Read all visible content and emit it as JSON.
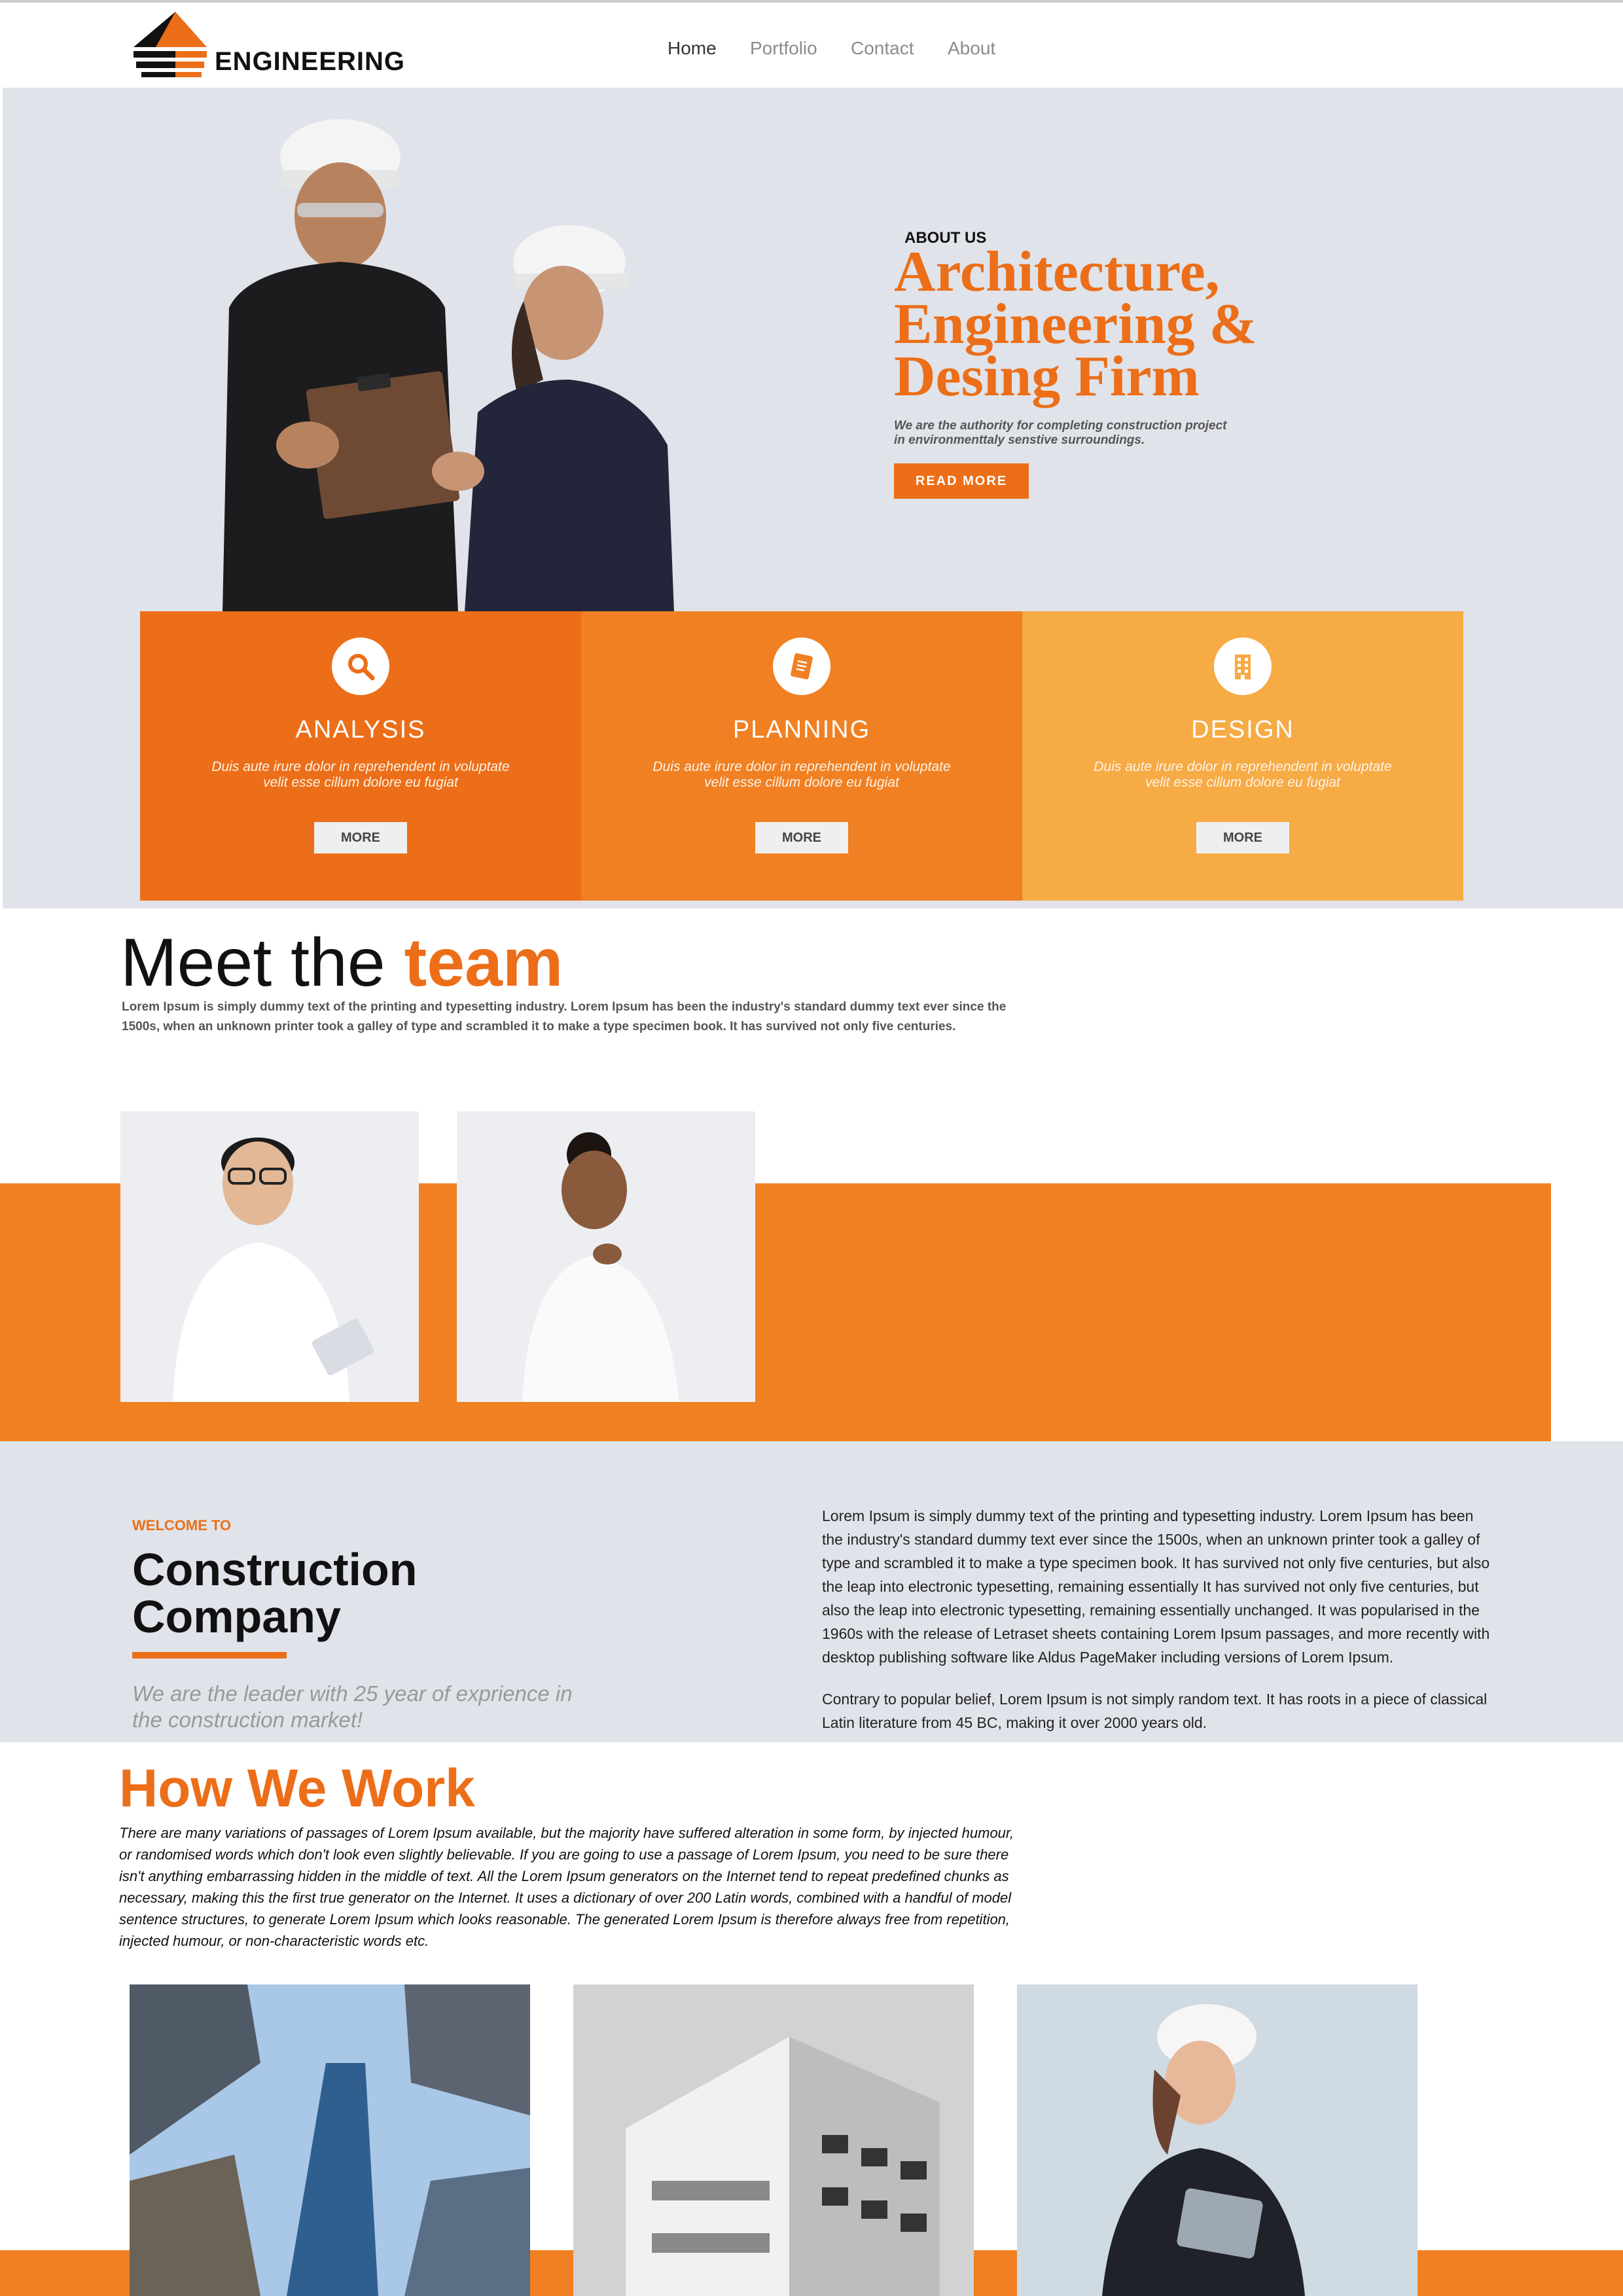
{
  "brand": {
    "name": "ENGINEERING",
    "accent": "#ec6e18"
  },
  "nav": [
    {
      "label": "Home",
      "active": true
    },
    {
      "label": "Portfolio",
      "active": false
    },
    {
      "label": "Contact",
      "active": false
    },
    {
      "label": "About",
      "active": false
    }
  ],
  "hero": {
    "kicker": "ABOUT US",
    "title_line1": "Architecture,",
    "title_line2": "Engineering &",
    "title_line3": "Desing Firm",
    "subtitle_line1": "We are the authority for completing construction project",
    "subtitle_line2": "in environmenttaly senstive surroundings.",
    "cta": "READ MORE"
  },
  "services": [
    {
      "title": "ANALYSIS",
      "icon": "search-icon",
      "desc_line1": "Duis aute irure dolor in reprehendent in voluptate",
      "desc_line2": "velit esse cillum dolore eu fugiat",
      "button": "MORE",
      "color": "#ec6e18"
    },
    {
      "title": "PLANNING",
      "icon": "book-icon",
      "desc_line1": "Duis aute irure dolor in reprehendent in voluptate",
      "desc_line2": "velit esse cillum dolore eu fugiat",
      "button": "MORE",
      "color": "#f08022"
    },
    {
      "title": "DESIGN",
      "icon": "building-icon",
      "desc_line1": "Duis aute irure dolor in reprehendent in voluptate",
      "desc_line2": "velit esse cillum dolore eu fugiat",
      "button": "MORE",
      "color": "#f6ab45"
    }
  ],
  "team": {
    "title_plain": "Meet the ",
    "title_accent": "team",
    "description": "Lorem Ipsum is simply dummy text of the printing and typesetting industry. Lorem Ipsum has been the industry's standard dummy text ever since the 1500s, when an unknown printer took a galley of type and scrambled it to make a type specimen book. It has survived not only five centuries."
  },
  "welcome": {
    "kicker": "WELCOME TO",
    "title_line1": "Construction",
    "title_line2": "Company",
    "subtitle": "We are the leader with 25 year of exprience in the construction market!",
    "paragraph1": "Lorem Ipsum is simply dummy text of the printing and typesetting industry. Lorem Ipsum has been the industry's standard dummy text ever since the 1500s, when an unknown printer took a galley of type and scrambled it to make a type specimen book. It has survived not only five centuries, but also the leap into electronic typesetting, remaining essentially It has survived not only five centuries, but also the leap into electronic typesetting, remaining essentially unchanged. It was popularised in the 1960s with the release of Letraset sheets containing Lorem Ipsum passages, and more recently with desktop publishing software like Aldus PageMaker including versions of Lorem Ipsum.",
    "paragraph2": "Contrary to popular belief, Lorem Ipsum is not simply random text. It has roots in a piece of classical Latin literature from 45 BC, making it over 2000 years old."
  },
  "how": {
    "title": "How We Work",
    "description": "There are many variations of passages of Lorem Ipsum available, but the majority have suffered alteration in some form, by injected humour, or randomised words which don't look even slightly believable. If you are going to use a passage of Lorem Ipsum, you need to be sure there isn't anything embarrassing hidden in the middle of text. All the Lorem Ipsum generators on the Internet tend to repeat predefined chunks as necessary, making this the first true generator on the Internet. It uses a dictionary of over 200 Latin words, combined with a handful of model sentence structures, to generate Lorem Ipsum which looks reasonable. The generated Lorem Ipsum is therefore always free from repetition, injected humour, or non-characteristic words etc."
  }
}
